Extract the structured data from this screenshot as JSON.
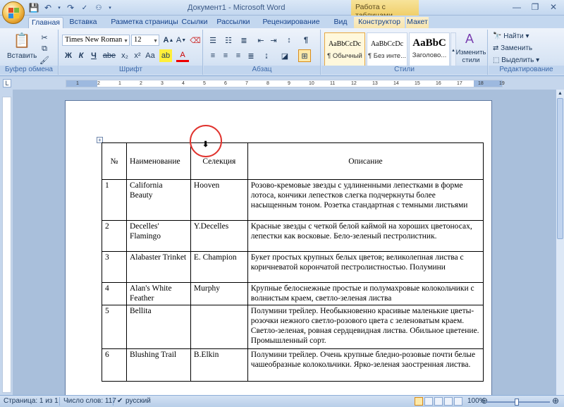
{
  "window": {
    "title": "Документ1 - Microsoft Word",
    "context_title": "Работа с таблицами"
  },
  "tabs": [
    "Главная",
    "Вставка",
    "Разметка страницы",
    "Ссылки",
    "Рассылки",
    "Рецензирование",
    "Вид",
    "Конструктор",
    "Макет"
  ],
  "ribbon": {
    "clipboard": {
      "paste": "Вставить",
      "label": "Буфер обмена"
    },
    "font": {
      "name": "Times New Roman",
      "size": "12",
      "label": "Шрифт",
      "bold": "Ж",
      "italic": "К",
      "underline": "Ч",
      "strike": "abe"
    },
    "paragraph": {
      "label": "Абзац"
    },
    "styles": {
      "label": "Стили",
      "items": [
        {
          "sample": "AaBbCcDc",
          "name": "¶ Обычный"
        },
        {
          "sample": "AaBbCcDc",
          "name": "¶ Без инте..."
        },
        {
          "sample": "AaBbC",
          "name": "Заголово..."
        }
      ],
      "change_styles": "Изменить стили"
    },
    "editing": {
      "label": "Редактирование",
      "find": "Найти",
      "replace": "Заменить",
      "select": "Выделить"
    }
  },
  "ruler_numbers": [
    "1",
    "2",
    "1",
    "2",
    "3",
    "4",
    "5",
    "6",
    "7",
    "8",
    "9",
    "10",
    "11",
    "12",
    "13",
    "14",
    "15",
    "16",
    "17",
    "18",
    "19"
  ],
  "table": {
    "headers": [
      "№",
      "Наименование",
      "Селекция",
      "Описание"
    ],
    "rows": [
      {
        "n": "1",
        "name": "California Beauty",
        "sel": "Hooven",
        "desc": "Розово-кремовые звезды с удлиненными лепестками в форме лотоса, кончики лепестков слегка подчеркнуты более насыщенным тоном. Розетка стандартная с темными листьями"
      },
      {
        "n": "2",
        "name": "Decelles' Flamingo",
        "sel": "Y.Decelles",
        "desc": "Красные звезды с четкой белой каймой на хороших цветоносах, лепестки как восковые. Бело-зеленый пестролистник."
      },
      {
        "n": "3",
        "name": "Alabaster Trinket",
        "sel": "E. Champion",
        "desc": "Букет простых крупных белых цветов; великолепная листва с коричневатой корончатой пестролистностью. Полумини"
      },
      {
        "n": "4",
        "name": "Alan's White Feather",
        "sel": "Murphy",
        "desc": "Крупные белоснежные простые и полумахровые колокольчики с волнистым краем, светло-зеленая листва"
      },
      {
        "n": "5",
        "name": "Bellita",
        "sel": "",
        "desc": "Полумини трейлер. Необыкновенно красивые маленькие цветы-розочки нежного светло-розового цвета с зеленоватым краем. Светло-зеленая, ровная сердцевидная листва. Обильное цветение. Промышленный сорт."
      },
      {
        "n": "6",
        "name": "Blushing Trail",
        "sel": "B.Elkin",
        "desc": "Полумини трейлер. Очень крупные бледно-розовые почти белые чашеобразные колокольчики. Ярко-зеленая заостренная листва."
      }
    ]
  },
  "status": {
    "page": "Страница: 1 из 1",
    "words": "Число слов: 117",
    "lang": "русский",
    "zoom": "100%"
  }
}
